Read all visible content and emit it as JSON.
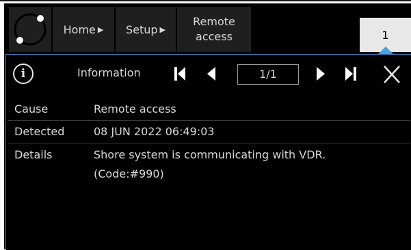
{
  "header": {
    "breadcrumbs": [
      {
        "label": "Home"
      },
      {
        "label": "Setup"
      },
      {
        "label_line1": "Remote",
        "label_line2": "access"
      }
    ],
    "alert_tab": "1"
  },
  "panel": {
    "title": "Information",
    "pager": "1/1",
    "fields": {
      "cause_label": "Cause",
      "cause_value": "Remote access",
      "detected_label": "Detected",
      "detected_value": "08 JUN 2022 06:49:03",
      "details_label": "Details",
      "details_line1": "Shore system is communicating with VDR.",
      "details_line2": "(Code:#990)"
    }
  },
  "colors": {
    "accent": "#4aa3df",
    "background": "#000000",
    "button": "#1f1f1f",
    "text": "#d9d9d9"
  },
  "icons": [
    "logo-ring-icon",
    "chevron-right-icon",
    "info-icon",
    "first-page-icon",
    "prev-page-icon",
    "next-page-icon",
    "last-page-icon",
    "close-icon"
  ]
}
